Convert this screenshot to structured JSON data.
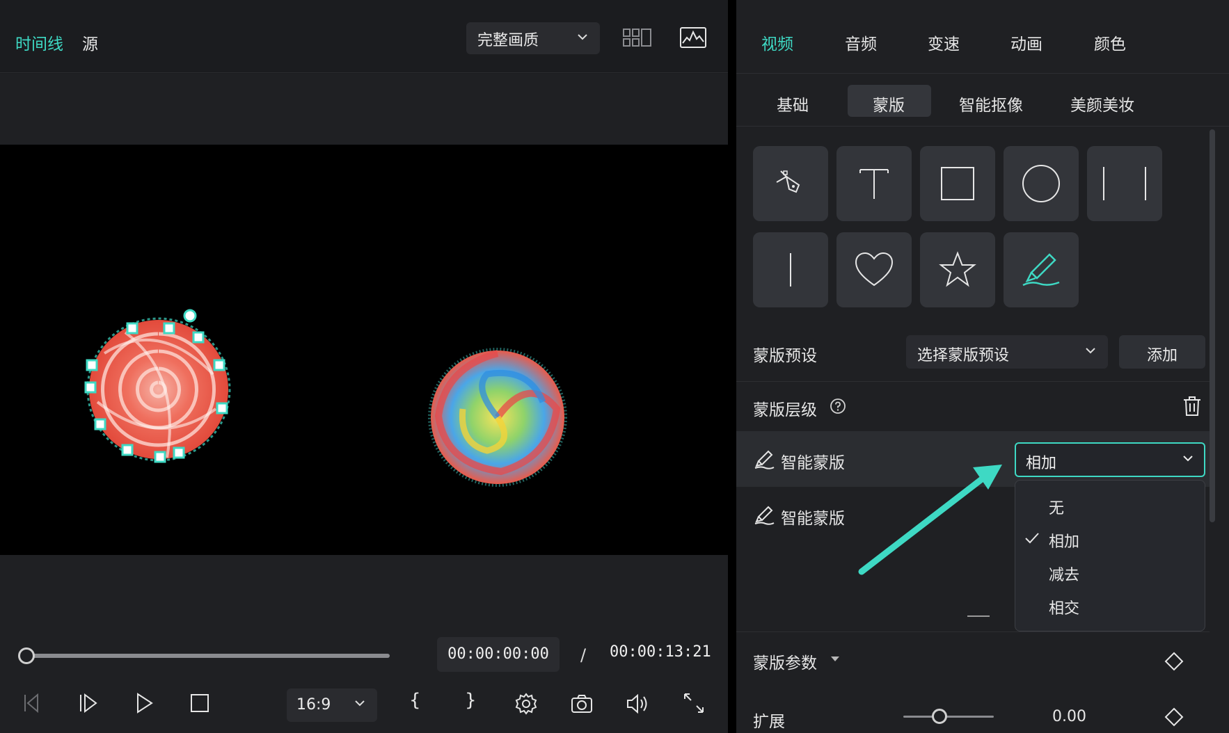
{
  "player": {
    "tabs": [
      {
        "label": "时间线",
        "active": true
      },
      {
        "label": "源",
        "active": false
      }
    ],
    "quality": "完整画质",
    "current_time": "00:00:00:00",
    "separator": "/",
    "total_time": "00:00:13:21",
    "aspect_ratio": "16:9",
    "open_brace": "{",
    "close_brace": "}"
  },
  "inspector": {
    "top_tabs": [
      "视频",
      "音频",
      "变速",
      "动画",
      "颜色"
    ],
    "sub_tabs": [
      "基础",
      "蒙版",
      "智能抠像",
      "美颜美妆"
    ],
    "active_top_tab": "视频",
    "active_sub_tab": "蒙版",
    "mask_shapes": [
      "pen-tool",
      "text",
      "rectangle",
      "circle",
      "mirror",
      "line",
      "heart",
      "star",
      "smart-brush"
    ],
    "preset": {
      "label": "蒙版预设",
      "placeholder": "选择蒙版预设",
      "add_button": "添加"
    },
    "layers": {
      "label": "蒙版层级",
      "rows": [
        {
          "name": "智能蒙版",
          "selected": true
        },
        {
          "name": "智能蒙版",
          "selected": false
        }
      ],
      "blend_value": "相加",
      "blend_options": [
        "无",
        "相加",
        "减去",
        "相交"
      ],
      "checked_option": "相加"
    },
    "params": {
      "label": "蒙版参数",
      "expand_label": "扩展",
      "expand_value": "0.00",
      "expand_slider_fraction": 0.4
    }
  },
  "colors": {
    "accent": "#3ed9c4",
    "panel_bg": "#1f2023"
  }
}
